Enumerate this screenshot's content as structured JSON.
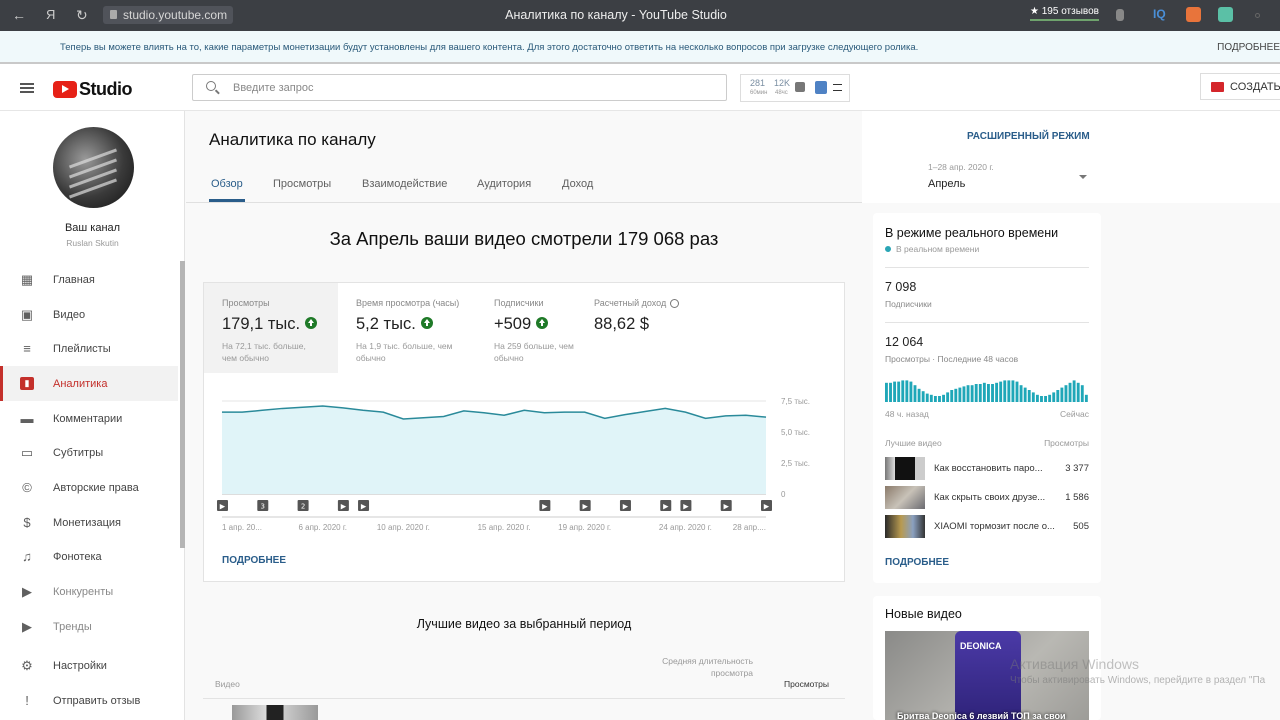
{
  "browser": {
    "url": "studio.youtube.com",
    "window_title": "Аналитика по каналу - YouTube Studio",
    "reviews": "★ 195 отзывов",
    "extensions": [
      "bookmark-icon",
      "iq-icon",
      "extension-orange-icon",
      "extension-green-icon"
    ]
  },
  "notice": {
    "text": "Теперь вы можете влиять на то, какие параметры монетизации будут установлены для вашего контента. Для этого достаточно ответить на несколько вопросов при загрузке следующего ролика.",
    "more": "ПОДРОБНЕЕ"
  },
  "topbar": {
    "logo": "Studio",
    "search_placeholder": "Введите запрос",
    "widget": {
      "n1": "281",
      "s1": "60мин",
      "n2": "12K",
      "s2": "48чс"
    },
    "create_label": "СОЗДАТЬ"
  },
  "sidebar": {
    "channel_name": "Ваш канал",
    "channel_user": "Ruslan Skutin",
    "items": [
      {
        "label": "Главная",
        "icon": "dashboard-icon"
      },
      {
        "label": "Видео",
        "icon": "video-library-icon"
      },
      {
        "label": "Плейлисты",
        "icon": "playlist-icon"
      },
      {
        "label": "Аналитика",
        "icon": "analytics-icon",
        "active": true
      },
      {
        "label": "Комментарии",
        "icon": "comment-icon"
      },
      {
        "label": "Субтитры",
        "icon": "subtitles-icon"
      },
      {
        "label": "Авторские права",
        "icon": "copyright-icon"
      },
      {
        "label": "Монетизация",
        "icon": "dollar-icon"
      },
      {
        "label": "Фонотека",
        "icon": "audio-library-icon"
      },
      {
        "label": "Конкуренты",
        "icon": "competitors-icon"
      },
      {
        "label": "Тренды",
        "icon": "trends-icon"
      },
      {
        "label": "Настройки",
        "icon": "gear-icon"
      },
      {
        "label": "Отправить отзыв",
        "icon": "feedback-icon"
      }
    ]
  },
  "main": {
    "title": "Аналитика по каналу",
    "advanced": "РАСШИРЕННЫЙ РЕЖИМ",
    "date_range": "1–28 апр. 2020 г.",
    "date_select": "Апрель",
    "tabs": [
      "Обзор",
      "Просмотры",
      "Взаимодействие",
      "Аудитория",
      "Доход"
    ],
    "headline": "За Апрель ваши видео смотрели 179 068 раз",
    "metrics": [
      {
        "label": "Просмотры",
        "value": "179,1 тыс.",
        "up": true,
        "sub": "На 72,1 тыс. больше, чем обычно"
      },
      {
        "label": "Время просмотра (часы)",
        "value": "5,2 тыс.",
        "up": true,
        "sub": "На 1,9 тыс. больше, чем обычно"
      },
      {
        "label": "Подписчики",
        "value": "+509",
        "up": true,
        "sub": "На 259 больше, чем обычно"
      },
      {
        "label": "Расчетный доход",
        "value": "88,62 $",
        "up": false,
        "sub": ""
      }
    ],
    "more": "ПОДРОБНЕЕ"
  },
  "chart_data": {
    "type": "area",
    "title": "",
    "xlabel": "",
    "ylabel": "Просмотры",
    "x": [
      "1 апр.",
      "2 апр.",
      "3 апр.",
      "4 апр.",
      "5 апр.",
      "6 апр.",
      "7 апр.",
      "8 апр.",
      "9 апр.",
      "10 апр.",
      "11 апр.",
      "12 апр.",
      "13 апр.",
      "14 апр.",
      "15 апр.",
      "16 апр.",
      "17 апр.",
      "18 апр.",
      "19 апр.",
      "20 апр.",
      "21 апр.",
      "22 апр.",
      "23 апр.",
      "24 апр.",
      "25 апр.",
      "26 апр.",
      "27 апр.",
      "28 апр."
    ],
    "values": [
      6600,
      6600,
      6750,
      6900,
      7000,
      7100,
      6950,
      6750,
      6600,
      6050,
      6150,
      6250,
      6700,
      6550,
      6350,
      6750,
      6550,
      6600,
      6600,
      6100,
      6400,
      6650,
      6900,
      6600,
      6100,
      6300,
      6350,
      6200
    ],
    "ylim": [
      0,
      7500
    ],
    "yticks": [
      "0",
      "2,5 тыс.",
      "5,0 тыс.",
      "7,5 тыс."
    ],
    "ytick_values": [
      0,
      2500,
      5000,
      7500
    ],
    "xtick_labels": [
      "1 апр. 20...",
      "6 апр. 2020 г.",
      "10 апр. 2020 г.",
      "15 апр. 2020 г.",
      "19 апр. 2020 г.",
      "24 апр. 2020 г.",
      "28 апр...."
    ],
    "xtick_index": [
      0,
      5,
      9,
      14,
      18,
      23,
      27
    ],
    "markers": [
      {
        "day": 0,
        "label": "▶"
      },
      {
        "day": 2,
        "label": "3"
      },
      {
        "day": 4,
        "label": "2"
      },
      {
        "day": 6,
        "label": "▶"
      },
      {
        "day": 7,
        "label": "▶"
      },
      {
        "day": 16,
        "label": "▶"
      },
      {
        "day": 18,
        "label": "▶"
      },
      {
        "day": 20,
        "label": "▶"
      },
      {
        "day": 22,
        "label": "▶"
      },
      {
        "day": 23,
        "label": "▶"
      },
      {
        "day": 25,
        "label": "▶"
      },
      {
        "day": 27,
        "label": "▶"
      }
    ],
    "grid": true,
    "color": "#2a8a9a",
    "fill": "#e0f4f8"
  },
  "realtime": {
    "title": "В режиме реального времени",
    "live": "В реальном времени",
    "subs_value": "7 098",
    "subs_label": "Подписчики",
    "views_value": "12 064",
    "views_label": "Просмотры · Последние 48 часов",
    "bars": [
      0.8,
      0.8,
      0.85,
      0.85,
      0.9,
      0.9,
      0.85,
      0.7,
      0.55,
      0.45,
      0.35,
      0.3,
      0.25,
      0.25,
      0.3,
      0.4,
      0.5,
      0.55,
      0.6,
      0.65,
      0.7,
      0.7,
      0.75,
      0.75,
      0.8,
      0.75,
      0.75,
      0.8,
      0.85,
      0.9,
      0.9,
      0.9,
      0.85,
      0.7,
      0.6,
      0.5,
      0.4,
      0.3,
      0.25,
      0.25,
      0.3,
      0.4,
      0.5,
      0.6,
      0.7,
      0.8,
      0.9,
      0.8,
      0.7,
      0.3
    ],
    "bar_color": "#1fa7b8",
    "from_label": "48 ч. назад",
    "to_label": "Сейчас",
    "top_label": "Лучшие видео",
    "views_col": "Просмотры",
    "videos": [
      {
        "title": "Как восстановить паро...",
        "views": "3 377"
      },
      {
        "title": "Как скрыть своих друзе...",
        "views": "1 586"
      },
      {
        "title": "XIAOMI тормозит после о...",
        "views": "505"
      }
    ],
    "more": "ПОДРОБНЕЕ"
  },
  "new_videos": {
    "title": "Новые видео",
    "brand": "DEONICA",
    "caption": "Бритва Deonica 6 лезвий ТОП за свои"
  },
  "top_videos": {
    "title": "Лучшие видео за выбранный период",
    "col_video": "Видео",
    "col_avg": "Средняя длительность просмотра",
    "col_views": "Просмотры"
  },
  "watermark": {
    "line1": "Активация Windows",
    "line2": "Чтобы активировать Windows, перейдите в раздел \"Па"
  }
}
